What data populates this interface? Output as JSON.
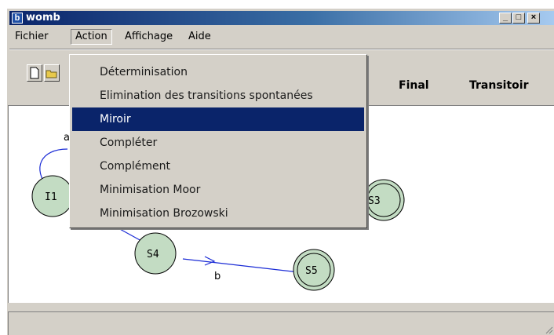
{
  "window": {
    "title": "womb",
    "icon": "app-icon"
  },
  "caption_buttons": [
    "minimize-icon",
    "maximize-icon",
    "close-icon"
  ],
  "menubar": {
    "items": [
      "Fichier",
      "Action",
      "Affichage",
      "Aide"
    ],
    "open": "Action"
  },
  "toolbar": {
    "columns": [
      "Final",
      "Transitoir"
    ],
    "buttons": [
      "new-file-icon",
      "open-folder-icon"
    ]
  },
  "action_menu": {
    "items": [
      "Déterminisation",
      "Elimination des transitions spontanées",
      "Miroir",
      "Compléter",
      "Complément",
      "Minimisation Moor",
      "Minimisation Brozowski"
    ],
    "highlighted": "Miroir"
  },
  "graph": {
    "states": [
      {
        "label": "I1",
        "kind": "initial"
      },
      {
        "label": "S3",
        "kind": "final"
      },
      {
        "label": "S4",
        "kind": "normal"
      },
      {
        "label": "S5",
        "kind": "final"
      }
    ],
    "transitions": [
      {
        "from": "I1",
        "to": "I1",
        "label": "a"
      },
      {
        "from": "S4",
        "to": "S5",
        "label": "b"
      }
    ]
  },
  "colors": {
    "state_fill": "#c3dcc3",
    "edge": "#1a2bd6",
    "selection": "#0a246a",
    "window": "#d4d0c8"
  }
}
